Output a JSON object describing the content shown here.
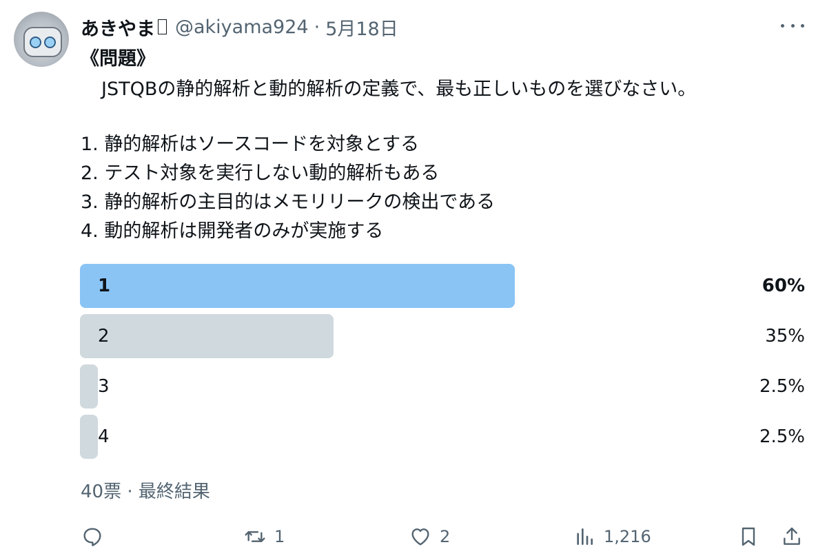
{
  "tweet": {
    "display_name": "あきやま",
    "handle": "@akiyama924",
    "separator": "·",
    "date": "5月18日",
    "title": "《問題》",
    "question": "JSTQBの静的解析と動的解析の定義で、最も正しいものを選びなさい。",
    "options": [
      "1. 静的解析はソースコードを対象とする",
      "2. テスト対象を実行しない動的解析もある",
      "3. 静的解析の主目的はメモリリークの検出である",
      "4. 動的解析は開発者のみが実施する"
    ]
  },
  "poll": {
    "winner_color": "#8ac4f5",
    "other_color": "#cfd9de",
    "results": [
      {
        "label": "1",
        "percent": 60,
        "percent_label": "60%"
      },
      {
        "label": "2",
        "percent": 35,
        "percent_label": "35%"
      },
      {
        "label": "3",
        "percent": 2.5,
        "percent_label": "2.5%"
      },
      {
        "label": "4",
        "percent": 2.5,
        "percent_label": "2.5%"
      }
    ],
    "summary": "40票 · 最終結果"
  },
  "actions": {
    "reply_count": "",
    "retweet_count": "1",
    "like_count": "2",
    "views_count": "1,216"
  },
  "icons": {
    "more": "more-icon",
    "reply": "reply-icon",
    "retweet": "retweet-icon",
    "like": "heart-icon",
    "views": "views-icon",
    "bookmark": "bookmark-icon",
    "share": "share-icon"
  }
}
